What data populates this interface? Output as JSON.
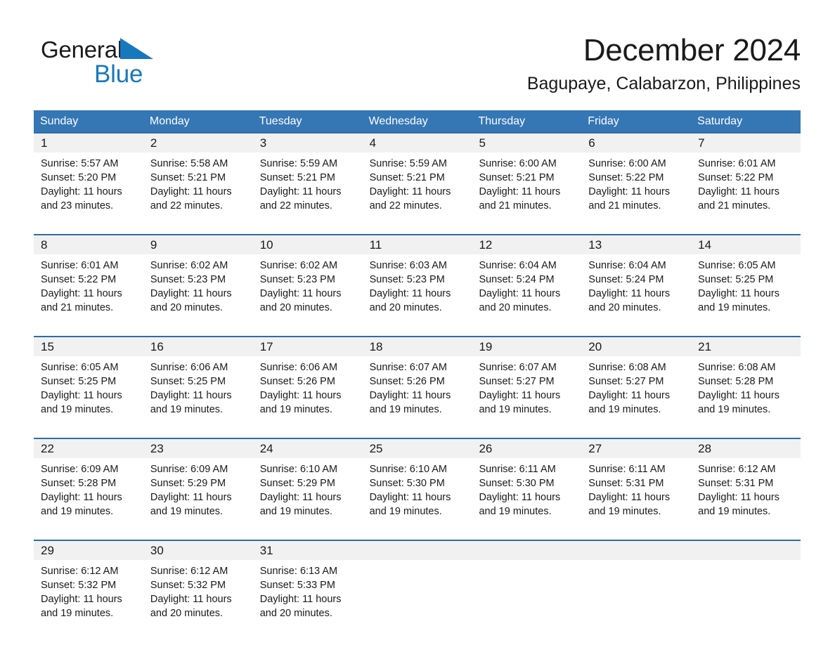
{
  "brand": {
    "name_part1": "General",
    "name_part2": "Blue",
    "accent_color": "#1878be"
  },
  "header": {
    "title": "December 2024",
    "subtitle": "Bagupaye, Calabarzon, Philippines"
  },
  "theme": {
    "header_blue": "#3576b5",
    "rule_blue": "#2e6da9",
    "date_band": "#f1f1f1"
  },
  "weekdays": [
    "Sunday",
    "Monday",
    "Tuesday",
    "Wednesday",
    "Thursday",
    "Friday",
    "Saturday"
  ],
  "weeks": [
    {
      "dates": [
        "1",
        "2",
        "3",
        "4",
        "5",
        "6",
        "7"
      ],
      "cells": [
        {
          "sunrise": "Sunrise: 5:57 AM",
          "sunset": "Sunset: 5:20 PM",
          "daylight1": "Daylight: 11 hours",
          "daylight2": "and 23 minutes."
        },
        {
          "sunrise": "Sunrise: 5:58 AM",
          "sunset": "Sunset: 5:21 PM",
          "daylight1": "Daylight: 11 hours",
          "daylight2": "and 22 minutes."
        },
        {
          "sunrise": "Sunrise: 5:59 AM",
          "sunset": "Sunset: 5:21 PM",
          "daylight1": "Daylight: 11 hours",
          "daylight2": "and 22 minutes."
        },
        {
          "sunrise": "Sunrise: 5:59 AM",
          "sunset": "Sunset: 5:21 PM",
          "daylight1": "Daylight: 11 hours",
          "daylight2": "and 22 minutes."
        },
        {
          "sunrise": "Sunrise: 6:00 AM",
          "sunset": "Sunset: 5:21 PM",
          "daylight1": "Daylight: 11 hours",
          "daylight2": "and 21 minutes."
        },
        {
          "sunrise": "Sunrise: 6:00 AM",
          "sunset": "Sunset: 5:22 PM",
          "daylight1": "Daylight: 11 hours",
          "daylight2": "and 21 minutes."
        },
        {
          "sunrise": "Sunrise: 6:01 AM",
          "sunset": "Sunset: 5:22 PM",
          "daylight1": "Daylight: 11 hours",
          "daylight2": "and 21 minutes."
        }
      ]
    },
    {
      "dates": [
        "8",
        "9",
        "10",
        "11",
        "12",
        "13",
        "14"
      ],
      "cells": [
        {
          "sunrise": "Sunrise: 6:01 AM",
          "sunset": "Sunset: 5:22 PM",
          "daylight1": "Daylight: 11 hours",
          "daylight2": "and 21 minutes."
        },
        {
          "sunrise": "Sunrise: 6:02 AM",
          "sunset": "Sunset: 5:23 PM",
          "daylight1": "Daylight: 11 hours",
          "daylight2": "and 20 minutes."
        },
        {
          "sunrise": "Sunrise: 6:02 AM",
          "sunset": "Sunset: 5:23 PM",
          "daylight1": "Daylight: 11 hours",
          "daylight2": "and 20 minutes."
        },
        {
          "sunrise": "Sunrise: 6:03 AM",
          "sunset": "Sunset: 5:23 PM",
          "daylight1": "Daylight: 11 hours",
          "daylight2": "and 20 minutes."
        },
        {
          "sunrise": "Sunrise: 6:04 AM",
          "sunset": "Sunset: 5:24 PM",
          "daylight1": "Daylight: 11 hours",
          "daylight2": "and 20 minutes."
        },
        {
          "sunrise": "Sunrise: 6:04 AM",
          "sunset": "Sunset: 5:24 PM",
          "daylight1": "Daylight: 11 hours",
          "daylight2": "and 20 minutes."
        },
        {
          "sunrise": "Sunrise: 6:05 AM",
          "sunset": "Sunset: 5:25 PM",
          "daylight1": "Daylight: 11 hours",
          "daylight2": "and 19 minutes."
        }
      ]
    },
    {
      "dates": [
        "15",
        "16",
        "17",
        "18",
        "19",
        "20",
        "21"
      ],
      "cells": [
        {
          "sunrise": "Sunrise: 6:05 AM",
          "sunset": "Sunset: 5:25 PM",
          "daylight1": "Daylight: 11 hours",
          "daylight2": "and 19 minutes."
        },
        {
          "sunrise": "Sunrise: 6:06 AM",
          "sunset": "Sunset: 5:25 PM",
          "daylight1": "Daylight: 11 hours",
          "daylight2": "and 19 minutes."
        },
        {
          "sunrise": "Sunrise: 6:06 AM",
          "sunset": "Sunset: 5:26 PM",
          "daylight1": "Daylight: 11 hours",
          "daylight2": "and 19 minutes."
        },
        {
          "sunrise": "Sunrise: 6:07 AM",
          "sunset": "Sunset: 5:26 PM",
          "daylight1": "Daylight: 11 hours",
          "daylight2": "and 19 minutes."
        },
        {
          "sunrise": "Sunrise: 6:07 AM",
          "sunset": "Sunset: 5:27 PM",
          "daylight1": "Daylight: 11 hours",
          "daylight2": "and 19 minutes."
        },
        {
          "sunrise": "Sunrise: 6:08 AM",
          "sunset": "Sunset: 5:27 PM",
          "daylight1": "Daylight: 11 hours",
          "daylight2": "and 19 minutes."
        },
        {
          "sunrise": "Sunrise: 6:08 AM",
          "sunset": "Sunset: 5:28 PM",
          "daylight1": "Daylight: 11 hours",
          "daylight2": "and 19 minutes."
        }
      ]
    },
    {
      "dates": [
        "22",
        "23",
        "24",
        "25",
        "26",
        "27",
        "28"
      ],
      "cells": [
        {
          "sunrise": "Sunrise: 6:09 AM",
          "sunset": "Sunset: 5:28 PM",
          "daylight1": "Daylight: 11 hours",
          "daylight2": "and 19 minutes."
        },
        {
          "sunrise": "Sunrise: 6:09 AM",
          "sunset": "Sunset: 5:29 PM",
          "daylight1": "Daylight: 11 hours",
          "daylight2": "and 19 minutes."
        },
        {
          "sunrise": "Sunrise: 6:10 AM",
          "sunset": "Sunset: 5:29 PM",
          "daylight1": "Daylight: 11 hours",
          "daylight2": "and 19 minutes."
        },
        {
          "sunrise": "Sunrise: 6:10 AM",
          "sunset": "Sunset: 5:30 PM",
          "daylight1": "Daylight: 11 hours",
          "daylight2": "and 19 minutes."
        },
        {
          "sunrise": "Sunrise: 6:11 AM",
          "sunset": "Sunset: 5:30 PM",
          "daylight1": "Daylight: 11 hours",
          "daylight2": "and 19 minutes."
        },
        {
          "sunrise": "Sunrise: 6:11 AM",
          "sunset": "Sunset: 5:31 PM",
          "daylight1": "Daylight: 11 hours",
          "daylight2": "and 19 minutes."
        },
        {
          "sunrise": "Sunrise: 6:12 AM",
          "sunset": "Sunset: 5:31 PM",
          "daylight1": "Daylight: 11 hours",
          "daylight2": "and 19 minutes."
        }
      ]
    },
    {
      "dates": [
        "29",
        "30",
        "31",
        "",
        "",
        "",
        ""
      ],
      "cells": [
        {
          "sunrise": "Sunrise: 6:12 AM",
          "sunset": "Sunset: 5:32 PM",
          "daylight1": "Daylight: 11 hours",
          "daylight2": "and 19 minutes."
        },
        {
          "sunrise": "Sunrise: 6:12 AM",
          "sunset": "Sunset: 5:32 PM",
          "daylight1": "Daylight: 11 hours",
          "daylight2": "and 20 minutes."
        },
        {
          "sunrise": "Sunrise: 6:13 AM",
          "sunset": "Sunset: 5:33 PM",
          "daylight1": "Daylight: 11 hours",
          "daylight2": "and 20 minutes."
        },
        {
          "sunrise": "",
          "sunset": "",
          "daylight1": "",
          "daylight2": ""
        },
        {
          "sunrise": "",
          "sunset": "",
          "daylight1": "",
          "daylight2": ""
        },
        {
          "sunrise": "",
          "sunset": "",
          "daylight1": "",
          "daylight2": ""
        },
        {
          "sunrise": "",
          "sunset": "",
          "daylight1": "",
          "daylight2": ""
        }
      ]
    }
  ]
}
